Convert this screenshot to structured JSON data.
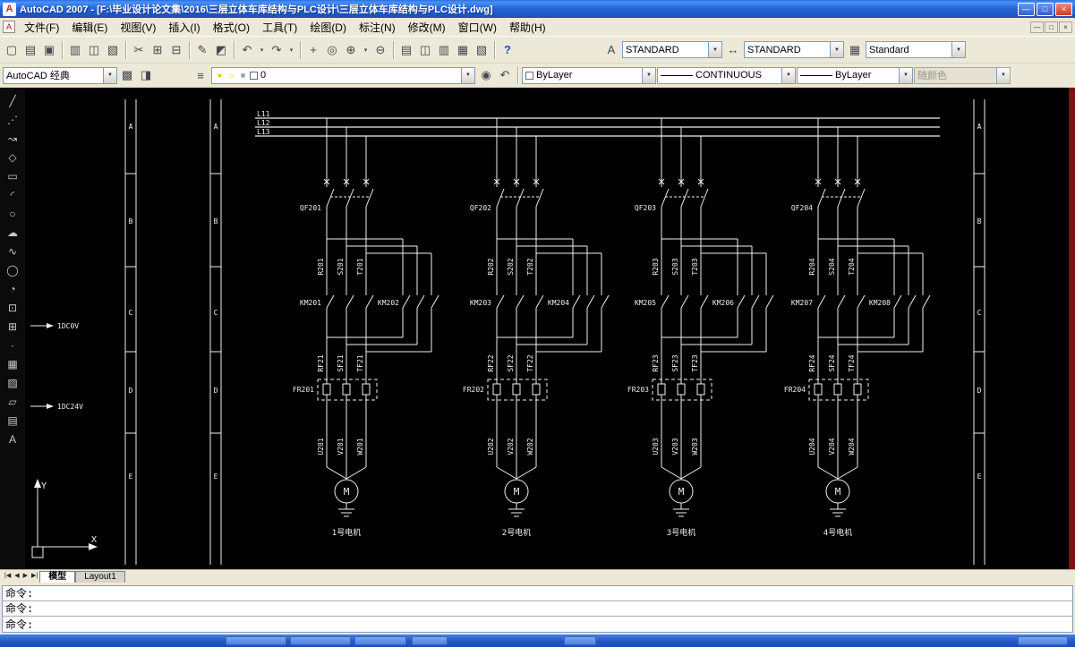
{
  "titlebar": {
    "title": "AutoCAD 2007 - [F:\\毕业设计论文集\\2016\\三层立体车库结构与PLC设计\\三层立体车库结构与PLC设计.dwg]",
    "app_icon_glyph": "A",
    "window_buttons": [
      {
        "name": "minimize-button",
        "glyph": "—"
      },
      {
        "name": "maximize-button",
        "glyph": "□"
      },
      {
        "name": "close-button",
        "glyph": "×"
      }
    ]
  },
  "menubar": {
    "dwg_icon_glyph": "A",
    "menus": [
      {
        "id": "file",
        "label": "文件(F)"
      },
      {
        "id": "edit",
        "label": "编辑(E)"
      },
      {
        "id": "view",
        "label": "视图(V)"
      },
      {
        "id": "insert",
        "label": "插入(I)"
      },
      {
        "id": "format",
        "label": "格式(O)"
      },
      {
        "id": "tools",
        "label": "工具(T)"
      },
      {
        "id": "draw",
        "label": "绘图(D)"
      },
      {
        "id": "dimension",
        "label": "标注(N)"
      },
      {
        "id": "modify",
        "label": "修改(M)"
      },
      {
        "id": "window",
        "label": "窗口(W)"
      },
      {
        "id": "help",
        "label": "帮助(H)"
      }
    ],
    "window_buttons": [
      {
        "name": "mdi-minimize-button",
        "glyph": "—"
      },
      {
        "name": "mdi-restore-button",
        "glyph": "□"
      },
      {
        "name": "mdi-close-button",
        "glyph": "×"
      }
    ]
  },
  "glyphs": {
    "dropdown": "▼"
  },
  "toolbar1": {
    "groups": [
      [
        {
          "name": "qnew-icon",
          "glyph": "▢"
        },
        {
          "name": "open-icon",
          "glyph": "▤"
        },
        {
          "name": "save-icon",
          "glyph": "▣"
        }
      ],
      [
        {
          "name": "plot-icon",
          "glyph": "▥"
        },
        {
          "name": "plot-preview-icon",
          "glyph": "◫"
        },
        {
          "name": "publish-icon",
          "glyph": "▧"
        }
      ],
      [
        {
          "name": "cut-icon",
          "glyph": "✂"
        },
        {
          "name": "copy-icon",
          "glyph": "⊞"
        },
        {
          "name": "paste-icon",
          "glyph": "⊟"
        }
      ],
      [
        {
          "name": "match-properties-icon",
          "glyph": "✎"
        },
        {
          "name": "block-editor-icon",
          "glyph": "◩"
        }
      ],
      [
        {
          "name": "undo-icon",
          "glyph": "↶"
        },
        {
          "name": "undo-dropdown-icon",
          "glyph": "▾",
          "small": true
        },
        {
          "name": "redo-icon",
          "glyph": "↷"
        },
        {
          "name": "redo-dropdown-icon",
          "glyph": "▾",
          "small": true
        }
      ],
      [
        {
          "name": "pan-icon",
          "glyph": "+"
        },
        {
          "name": "zoom-realtime-icon",
          "glyph": "◎"
        },
        {
          "name": "zoom-window-icon",
          "glyph": "⊕"
        },
        {
          "name": "zoom-flyout-icon",
          "glyph": "▾",
          "small": true
        },
        {
          "name": "zoom-previous-icon",
          "glyph": "⊖"
        }
      ],
      [
        {
          "name": "properties-icon",
          "glyph": "▤"
        },
        {
          "name": "designcenter-icon",
          "glyph": "◫"
        },
        {
          "name": "tool-palettes-icon",
          "glyph": "▥"
        },
        {
          "name": "sheet-set-manager-icon",
          "glyph": "▦"
        },
        {
          "name": "markup-set-manager-icon",
          "glyph": "▧"
        }
      ],
      [
        {
          "name": "help-icon",
          "glyph": "?",
          "color": "#1a50c8"
        }
      ]
    ],
    "text_style_icon": "A",
    "dim_style_icon": "↔",
    "table_style_icon": "▦",
    "text_style": "STANDARD",
    "dim_style": "STANDARD",
    "table_style": "Standard"
  },
  "toolbar2": {
    "workspace": "AutoCAD 经典",
    "workspace_icons": [
      {
        "name": "workspace-toggle-icon",
        "glyph": "▩"
      },
      {
        "name": "workspace-settings-icon",
        "glyph": "◨"
      }
    ],
    "layer_manager_icon": "≡",
    "layer_icons": [
      {
        "name": "layer-on-icon",
        "kind": "glyph",
        "glyph": "●",
        "color": "#E8C90A"
      },
      {
        "name": "layer-freeze-icon",
        "kind": "glyph",
        "glyph": "☼",
        "color": "#E8C90A"
      },
      {
        "name": "layer-lock-icon",
        "kind": "glyph",
        "glyph": "■",
        "color": "#8FA3C0"
      },
      {
        "name": "layer-color-swatch",
        "kind": "swatch",
        "color": "#FFFFFF"
      }
    ],
    "layer_value": "0",
    "layer_tool_icons": [
      {
        "name": "make-object-layer-current-icon",
        "glyph": "◉"
      },
      {
        "name": "layer-previous-icon",
        "glyph": "↶"
      }
    ],
    "color_swatch": "#FFFFFF",
    "color_value": "ByLayer",
    "linetype_value": "CONTINUOUS",
    "lineweight_value": "ByLayer",
    "plot_style_value": "随颜色"
  },
  "draw_toolbar": {
    "icons": [
      {
        "name": "line-icon",
        "glyph": "╱"
      },
      {
        "name": "construction-line-icon",
        "glyph": "⋰"
      },
      {
        "name": "polyline-icon",
        "glyph": "↝"
      },
      {
        "name": "polygon-icon",
        "glyph": "◇"
      },
      {
        "name": "rectangle-icon",
        "glyph": "▭"
      },
      {
        "name": "arc-icon",
        "glyph": "◜"
      },
      {
        "name": "circle-icon",
        "glyph": "○"
      },
      {
        "name": "revision-cloud-icon",
        "glyph": "☁"
      },
      {
        "name": "spline-icon",
        "glyph": "∿"
      },
      {
        "name": "ellipse-icon",
        "glyph": "◯"
      },
      {
        "name": "ellipse-arc-icon",
        "glyph": "◔"
      },
      {
        "name": "insert-block-icon",
        "glyph": "⊡"
      },
      {
        "name": "make-block-icon",
        "glyph": "⊞"
      },
      {
        "name": "point-icon",
        "glyph": "·"
      },
      {
        "name": "hatch-icon",
        "glyph": "▦"
      },
      {
        "name": "gradient-icon",
        "glyph": "▨"
      },
      {
        "name": "region-icon",
        "glyph": "▱"
      },
      {
        "name": "table-icon",
        "glyph": "▤"
      },
      {
        "name": "multiline-text-icon",
        "glyph": "A"
      }
    ]
  },
  "tabs": {
    "nav": [
      "|◀",
      "◀",
      "▶",
      "▶|"
    ],
    "model": "模型",
    "layout": "Layout1"
  },
  "command": {
    "history": [
      "命令:",
      "命令:"
    ],
    "prompt": "命令:"
  },
  "schematic": {
    "power_lines": [
      "L11",
      "L12",
      "L13"
    ],
    "zones": [
      "A",
      "B",
      "C",
      "D",
      "E"
    ],
    "annotations": [
      "1DC0V",
      "1DC24V"
    ],
    "motor_symbol": "M",
    "ucs": {
      "x": "X",
      "y": "Y"
    },
    "branches": [
      {
        "qf": "QF201",
        "phases": [
          "R201",
          "S201",
          "T201"
        ],
        "km_left": "KM201",
        "km_right": "KM202",
        "thermal_phases": [
          "RF21",
          "SF21",
          "TF21"
        ],
        "fr": "FR201",
        "leads": [
          "U201",
          "V201",
          "W201"
        ],
        "motor": "1号电机"
      },
      {
        "qf": "QF202",
        "phases": [
          "R202",
          "S202",
          "T202"
        ],
        "km_left": "KM203",
        "km_right": "KM204",
        "thermal_phases": [
          "RF22",
          "SF22",
          "TF22"
        ],
        "fr": "FR202",
        "leads": [
          "U202",
          "V202",
          "W202"
        ],
        "motor": "2号电机"
      },
      {
        "qf": "QF203",
        "phases": [
          "R203",
          "S203",
          "T203"
        ],
        "km_left": "KM205",
        "km_right": "KM206",
        "thermal_phases": [
          "RF23",
          "SF23",
          "TF23"
        ],
        "fr": "FR203",
        "leads": [
          "U203",
          "V203",
          "W203"
        ],
        "motor": "3号电机"
      },
      {
        "qf": "QF204",
        "phases": [
          "R204",
          "S204",
          "T204"
        ],
        "km_left": "KM207",
        "km_right": "KM208",
        "thermal_phases": [
          "RF24",
          "SF24",
          "TF24"
        ],
        "fr": "FR204",
        "leads": [
          "U204",
          "V204",
          "W204"
        ],
        "motor": "4号电机"
      }
    ]
  }
}
